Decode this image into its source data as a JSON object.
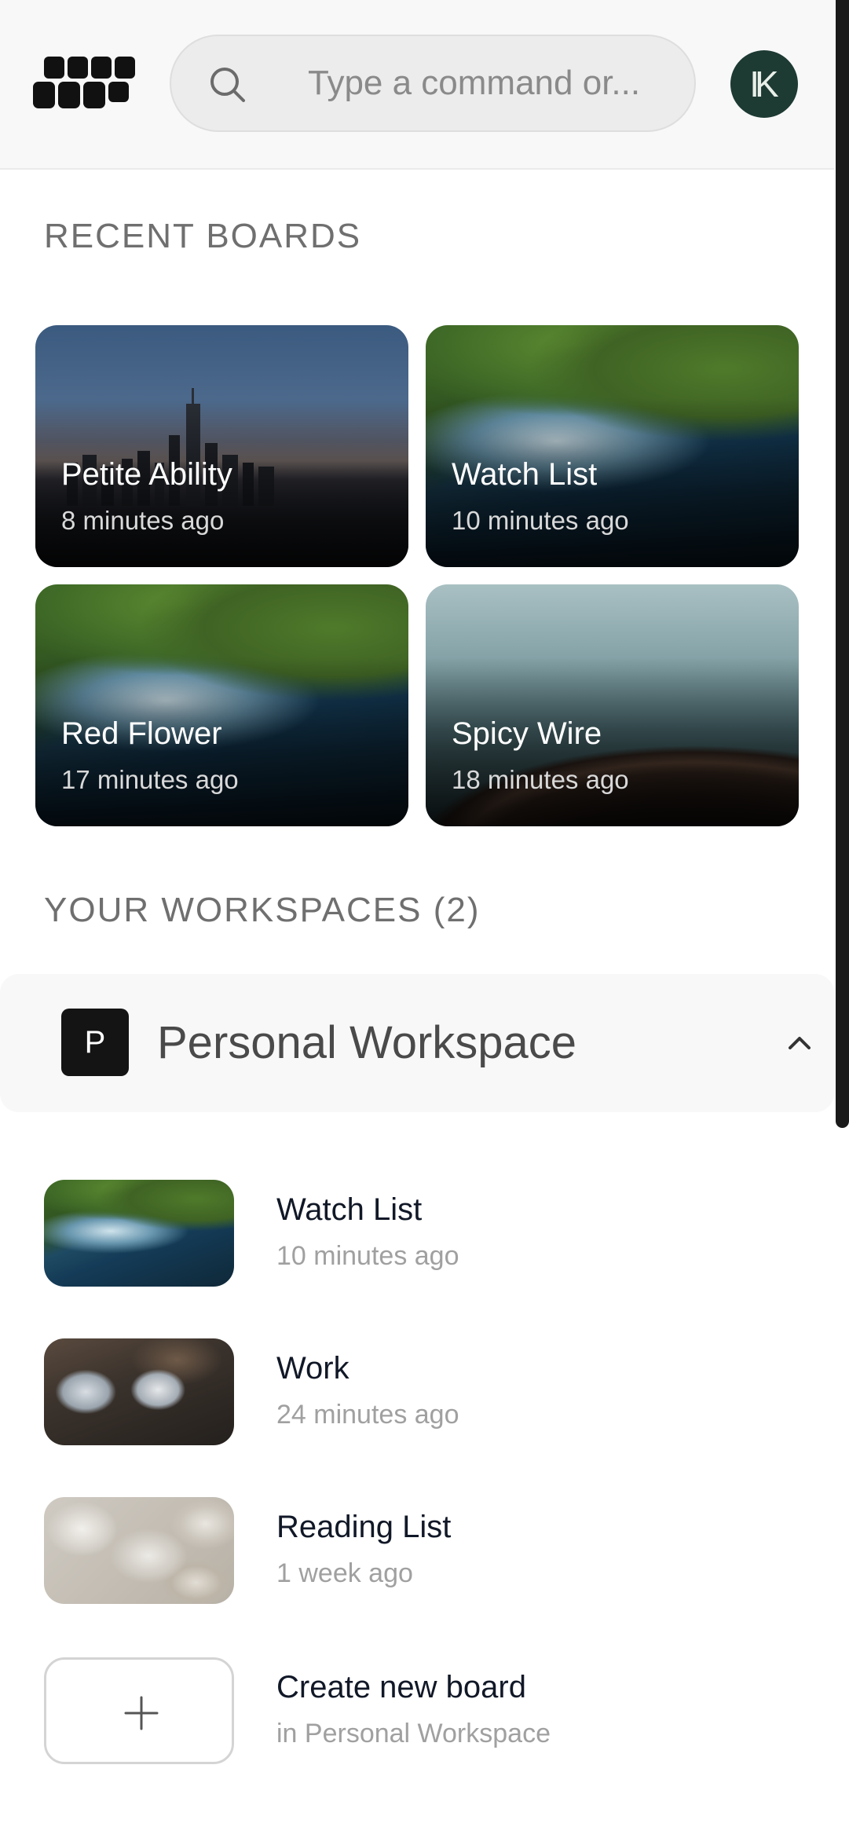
{
  "header": {
    "search_placeholder": "Type a command or...",
    "avatar_initials": "IK",
    "logo_icon": "brick-logo-icon",
    "search_icon": "search-icon"
  },
  "recent": {
    "title": "RECENT BOARDS",
    "boards": [
      {
        "name": "Petite Ability",
        "time": "8 minutes ago"
      },
      {
        "name": "Watch List",
        "time": "10 minutes ago"
      },
      {
        "name": "Red Flower",
        "time": "17 minutes ago"
      },
      {
        "name": "Spicy Wire",
        "time": "18 minutes ago"
      }
    ]
  },
  "workspaces": {
    "title": "YOUR WORKSPACES (2)",
    "personal": {
      "badge": "P",
      "name": "Personal Workspace",
      "chevron_icon": "chevron-up-icon"
    },
    "boards": [
      {
        "name": "Watch List",
        "time": "10 minutes ago"
      },
      {
        "name": "Work",
        "time": "24 minutes ago"
      },
      {
        "name": "Reading List",
        "time": "1 week ago"
      }
    ],
    "create": {
      "label": "Create new board",
      "sub": "in Personal Workspace",
      "icon": "plus-icon"
    }
  },
  "colors": {
    "avatar_bg": "#1d3a33",
    "badge_bg": "#141414",
    "header_bg": "#f8f8f8"
  }
}
